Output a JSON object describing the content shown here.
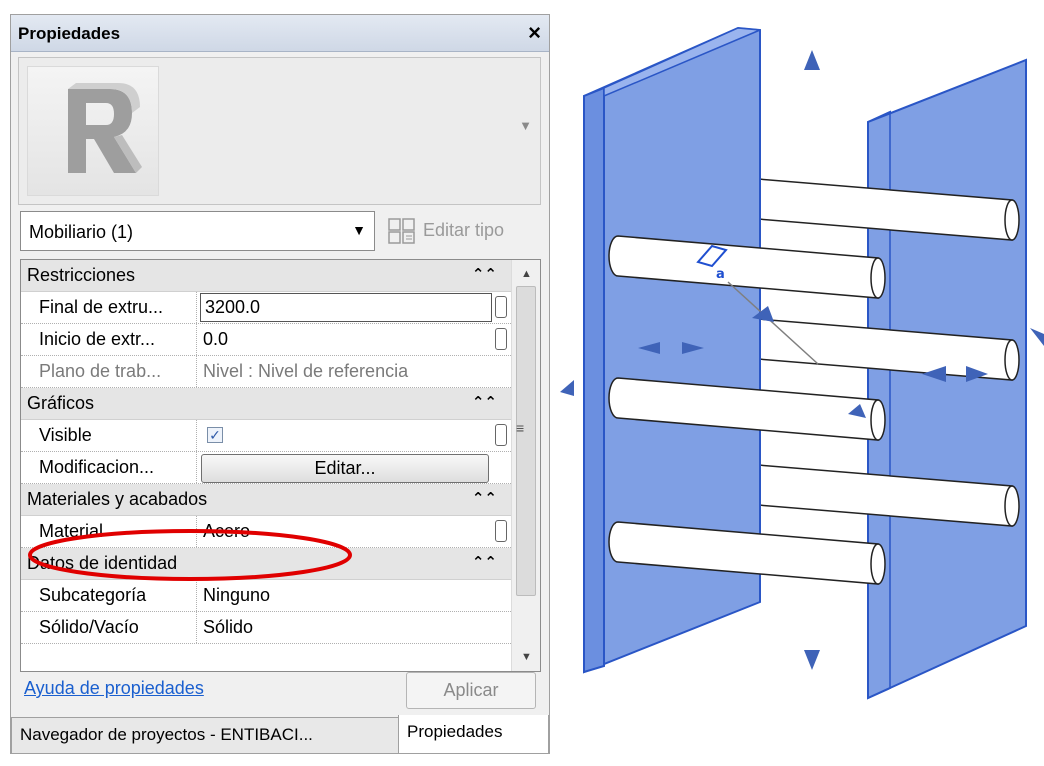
{
  "palette": {
    "title": "Propiedades",
    "close_glyph": "×",
    "type_selector": {
      "value": "Mobiliario (1)"
    },
    "edit_type_label": "Editar tipo",
    "groups": [
      {
        "label": "Restricciones",
        "rows": [
          {
            "key": "Final de extru...",
            "value": "3200.0",
            "editing": true
          },
          {
            "key": "Inicio de extr...",
            "value": "0.0"
          },
          {
            "key": "Plano de trab...",
            "value": "Nivel : Nivel de referencia",
            "disabled": true
          }
        ]
      },
      {
        "label": "Gráficos",
        "rows": [
          {
            "key": "Visible",
            "checked": true
          },
          {
            "key": "Modificacion...",
            "button": "Editar..."
          }
        ]
      },
      {
        "label": "Materiales y acabados",
        "rows": [
          {
            "key": "Material",
            "value": "Acero",
            "highlighted": true
          }
        ]
      },
      {
        "label": "Datos de identidad",
        "rows": [
          {
            "key": "Subcategoría",
            "value": "Ninguno"
          },
          {
            "key": "Sólido/Vacío",
            "value": "Sólido"
          }
        ]
      }
    ],
    "help_link": "Ayuda de propiedades",
    "apply_label": "Aplicar",
    "tabs": [
      "Navegador de proyectos - ENTIBACI...",
      "Propiedades"
    ],
    "active_tab": "Propiedades"
  },
  "view3d": {
    "panel_color": "#7f9fe4",
    "panel_edge_color": "#2a56c6",
    "bar_count": 6,
    "arrow_color": "#3f63b8"
  }
}
